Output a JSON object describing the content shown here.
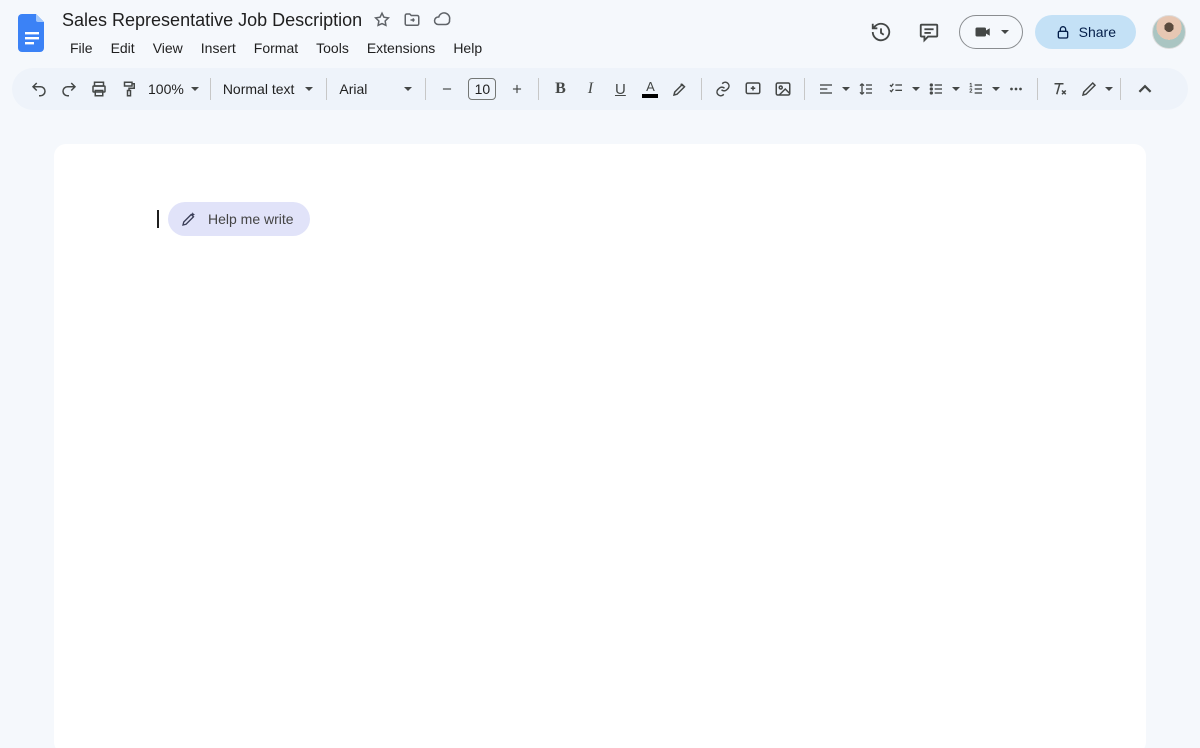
{
  "doc": {
    "title": "Sales Representative Job Description"
  },
  "menus": [
    "File",
    "Edit",
    "View",
    "Insert",
    "Format",
    "Tools",
    "Extensions",
    "Help"
  ],
  "header": {
    "share_label": "Share"
  },
  "toolbar": {
    "zoom": "100%",
    "paragraph_style": "Normal text",
    "font_family": "Arial",
    "font_size": "10",
    "text_color": "#000000",
    "highlight_color": "#fdd663"
  },
  "document": {
    "help_chip_label": "Help me write"
  }
}
